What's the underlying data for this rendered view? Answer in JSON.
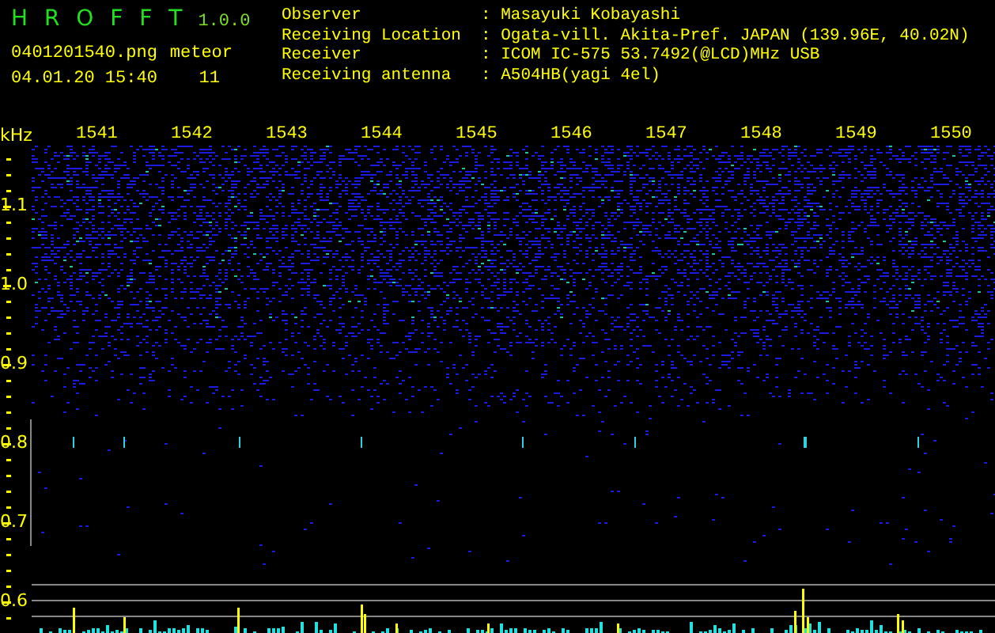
{
  "app": {
    "name": "H R O F F T",
    "version": "1.0.0"
  },
  "file_name": "0401201540.png",
  "timestamp": "04.01.20 15:40",
  "meteor": {
    "label": "meteor",
    "count": "11"
  },
  "info": [
    {
      "label": "Observer",
      "value": ": Masayuki Kobayashi"
    },
    {
      "label": "Receiving Location",
      "value": ": Ogata-vill. Akita-Pref. JAPAN (139.96E, 40.02N)"
    },
    {
      "label": "Receiver",
      "value": ": ICOM IC-575 53.7492(@LCD)MHz USB"
    },
    {
      "label": "Receiving antenna",
      "value": ": A504HB(yagi 4el)"
    }
  ],
  "axis": {
    "unit": "kHz",
    "x_labels": [
      "1541",
      "1542",
      "1543",
      "1544",
      "1545",
      "1546",
      "1547",
      "1548",
      "1549",
      "1550"
    ],
    "y_labels": [
      "1.1",
      "1.0",
      "0.9",
      "0.8",
      "0.7",
      "0.6"
    ]
  }
}
